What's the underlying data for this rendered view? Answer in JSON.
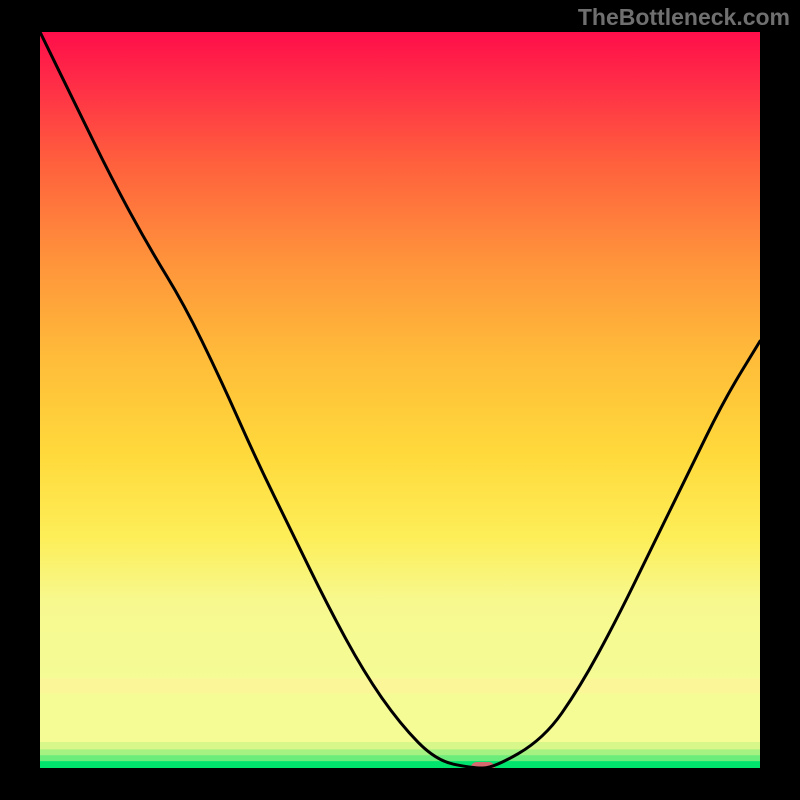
{
  "watermark": "TheBottleneck.com",
  "chart_data": {
    "type": "line",
    "title": "",
    "xlabel": "",
    "ylabel": "",
    "x": [
      0.0,
      0.05,
      0.1,
      0.15,
      0.2,
      0.25,
      0.3,
      0.35,
      0.4,
      0.45,
      0.5,
      0.55,
      0.6,
      0.63,
      0.7,
      0.75,
      0.8,
      0.85,
      0.9,
      0.95,
      1.0
    ],
    "values": [
      1.0,
      0.9,
      0.8,
      0.71,
      0.63,
      0.53,
      0.42,
      0.32,
      0.22,
      0.13,
      0.06,
      0.01,
      0.0,
      0.0,
      0.04,
      0.11,
      0.2,
      0.3,
      0.4,
      0.5,
      0.58
    ],
    "xlim": [
      0,
      1
    ],
    "ylim": [
      0,
      1
    ],
    "legend": null,
    "marker": {
      "x": 0.615,
      "y": 0.0,
      "color": "#d66a6f"
    },
    "bottom_bands": [
      {
        "color": "#00e46e",
        "thickness": 0.01
      },
      {
        "color": "#6cec7a",
        "thickness": 0.008
      },
      {
        "color": "#a5f181",
        "thickness": 0.008
      },
      {
        "color": "#d7f78b",
        "thickness": 0.01
      },
      {
        "color": "#f5fb95",
        "thickness": 0.066
      },
      {
        "color": "#fbf798",
        "thickness": 0.02
      }
    ],
    "gradient_top_color": "#ff0e4a",
    "gradient_mid_color": "#ffd73a",
    "gradient_bottom_color": "#00e46e"
  }
}
